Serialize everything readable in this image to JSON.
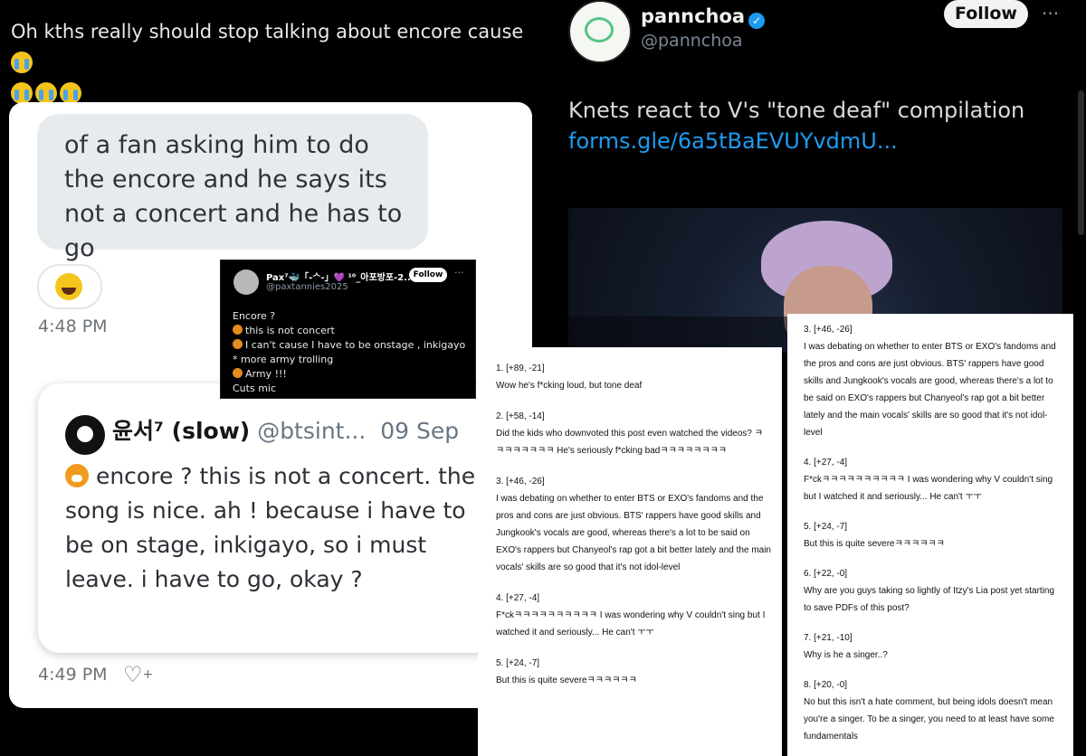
{
  "caption": {
    "text": "Oh kths really should stop talking about encore cause",
    "emoji": "loudly-crying-face"
  },
  "left_chat": {
    "bubble_text": "of a fan asking him to do the encore and he says its not a concert and he has to go",
    "reaction_emoji": "laughing-tears-face",
    "time1": "4:48 PM",
    "reply": {
      "name": "윤서⁷ (slow)",
      "handle": "@btsint...",
      "date": "09 Sep",
      "body": "encore ? this is not a concert. the song is nice.  ah ! because i have to be on stage, inkigayo, so i must leave. i have to go, okay ?",
      "tiger_emoji": "tiger-face"
    },
    "time2": "4:49 PM",
    "heart_plus_icon": "heart-plus-icon"
  },
  "small_tweet": {
    "name": "Pax⁷🐳「-ᄉ-」💜 ¹⁰_아포방포-2...",
    "handle": "@paxtannies2025",
    "follow_label": "Follow",
    "more": "···",
    "lines": [
      "Encore ?",
      "this is not concert",
      "I can't cause I have to be onstage , inkigayo",
      "* more army trolling",
      "Army !!!",
      "Cuts mic"
    ]
  },
  "right_post": {
    "name": "pannchoa",
    "verified": "✓",
    "handle": "@pannchoa",
    "follow_label": "Follow",
    "more": "···",
    "text": "Knets react to V's \"tone deaf\" compilation",
    "link": "forms.gle/6a5tBaEVUYvdmU..."
  },
  "comments_left": [
    {
      "meta": "1. [+89, -21]",
      "text": "Wow he's f*cking loud, but tone deaf"
    },
    {
      "meta": "2. [+58, -14]",
      "text": "Did the kids who downvoted this post even watched the videos? ㅋㅋㅋㅋㅋㅋㅋㅋ He's seriously f*cking badㅋㅋㅋㅋㅋㅋㅋㅋ"
    },
    {
      "meta": "3. [+46, -26]",
      "text": "I was debating on whether to enter BTS or EXO's fandoms and the pros and cons are just obvious. BTS' rappers have good skills and Jungkook's vocals are good, whereas there's a lot to be said on EXO's rappers but Chanyeol's rap got a bit better lately and the main vocals' skills are so good that it's not idol-level"
    },
    {
      "meta": "4. [+27, -4]",
      "text": "F*ckㅋㅋㅋㅋㅋㅋㅋㅋㅋㅋ I was wondering why V couldn't sing but I watched it and seriously... He can't ㅜㅜ"
    },
    {
      "meta": "5. [+24, -7]",
      "text": "But this is quite severeㅋㅋㅋㅋㅋㅋ"
    }
  ],
  "comments_right": [
    {
      "meta": "3. [+46, -26]",
      "text": "I was debating on whether to enter BTS or EXO's fandoms and the pros and cons are just obvious. BTS' rappers have good skills and Jungkook's vocals are good, whereas there's a lot to be said on EXO's rappers but Chanyeol's rap got a bit better lately and the main vocals' skills are so good that it's not idol-level"
    },
    {
      "meta": "4. [+27, -4]",
      "text": "F*ckㅋㅋㅋㅋㅋㅋㅋㅋㅋㅋ I was wondering why V couldn't sing but I watched it and seriously... He can't ㅜㅜ"
    },
    {
      "meta": "5. [+24, -7]",
      "text": "But this is quite severeㅋㅋㅋㅋㅋㅋ"
    },
    {
      "meta": "6. [+22, -0]",
      "text": "Why are you guys taking so lightly of Itzy's Lia post yet starting to save PDFs of this post?"
    },
    {
      "meta": "7. [+21, -10]",
      "text": "Why is he a singer..?"
    },
    {
      "meta": "8. [+20, -0]",
      "text": "No but this isn't a hate comment, but being idols doesn't mean you're a singer. To be a singer, you need to at least have some fundamentals"
    }
  ]
}
